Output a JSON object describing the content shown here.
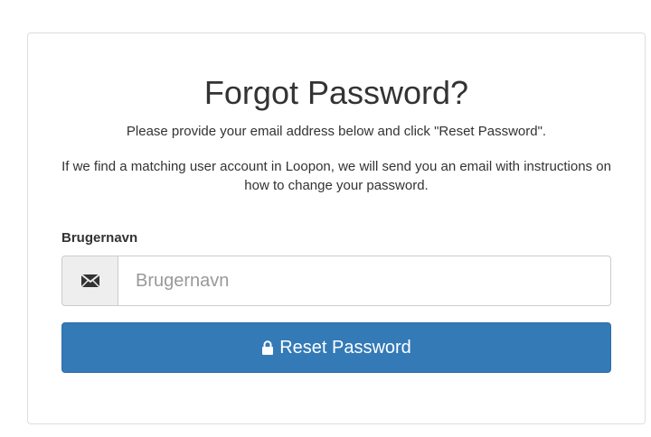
{
  "title": "Forgot Password?",
  "instruction": "Please provide your email address below and click \"Reset Password\".",
  "info": "If we find a matching user account in Loopon, we will send you an email with instructions on how to change your password.",
  "form": {
    "label": "Brugernavn",
    "input_value": "",
    "placeholder": "Brugernavn",
    "addon_icon": "envelope-icon"
  },
  "button": {
    "label": "Reset Password",
    "icon": "lock-icon"
  },
  "colors": {
    "primary": "#337ab7",
    "border": "#dddddd",
    "addon_bg": "#eeeeee"
  }
}
